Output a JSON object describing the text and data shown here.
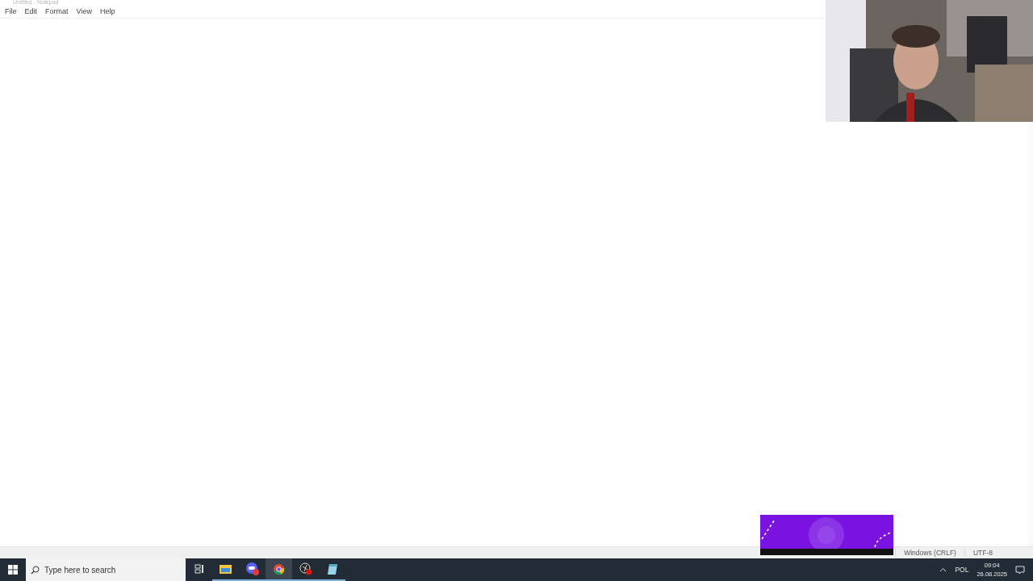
{
  "window": {
    "title": "Untitled - Notepad"
  },
  "menu": [
    "File",
    "Edit",
    "Format",
    "View",
    "Help"
  ],
  "editor": {
    "kind": "text"
  },
  "status_bar": [
    "Windows (CRLF)",
    "UTF-8"
  ],
  "taskbar": {
    "search": {
      "placeholder": "Type here to search"
    },
    "apps": [
      {
        "kind": "taskview",
        "selected": false,
        "running": false
      },
      {
        "kind": "folder",
        "selected": false,
        "running": true
      },
      {
        "kind": "chat",
        "selected": false,
        "running": true
      },
      {
        "kind": "browser",
        "selected": true,
        "running": true
      },
      {
        "kind": "recorder",
        "selected": false,
        "running": true
      },
      {
        "kind": "notepad",
        "selected": false,
        "running": true
      }
    ],
    "language": "POL",
    "time": "09:04",
    "date": "26.08.2025"
  }
}
